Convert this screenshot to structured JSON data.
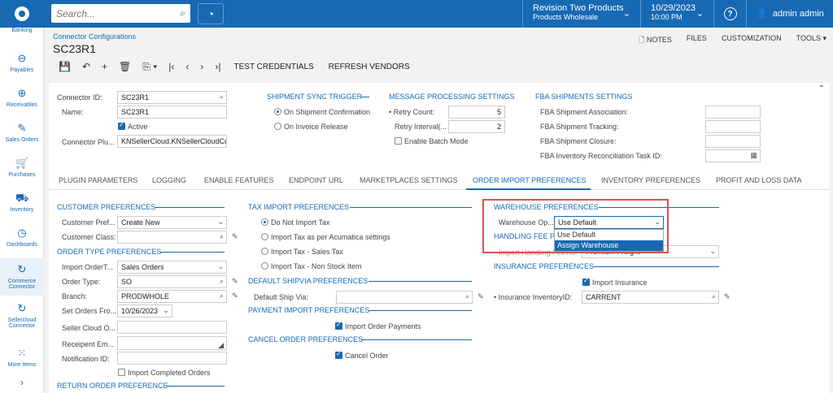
{
  "topbar": {
    "search_placeholder": "Search...",
    "company_name": "Revision Two Products",
    "company_sub": "Products Wholesale",
    "date": "10/29/2023",
    "time": "10:00 PM",
    "user": "admin admin"
  },
  "sidebar": {
    "items": [
      {
        "label": "Banking"
      },
      {
        "label": "Payables"
      },
      {
        "label": "Receivables"
      },
      {
        "label": "Sales Orders"
      },
      {
        "label": "Purchases"
      },
      {
        "label": "Inventory"
      },
      {
        "label": "Dashboards"
      },
      {
        "label": "Commerce Connector"
      },
      {
        "label": "Sellercloud Connector"
      },
      {
        "label": "More Items"
      }
    ]
  },
  "header": {
    "breadcrumb": "Connector Configurations",
    "title": "SC23R1",
    "notes": "NOTES",
    "files": "FILES",
    "customization": "CUSTOMIZATION",
    "tools": "TOOLS",
    "test_credentials": "TEST CREDENTIALS",
    "refresh_vendors": "REFRESH VENDORS"
  },
  "summary": {
    "connector_id_label": "Connector ID:",
    "connector_id": "SC23R1",
    "name_label": "Name:",
    "name": "SC23R1",
    "active_label": "Active",
    "plugin_label": "Connector Plu...",
    "plugin": "KNSellerCloud.KNSellerCloudCo",
    "shipment_sync_title": "SHIPMENT SYNC TRIGGER",
    "on_shipment": "On Shipment Confirmation",
    "on_invoice": "On Invoice Release",
    "msg_title": "MESSAGE PROCESSING SETTINGS",
    "retry_count_label": "Retry Count:",
    "retry_count": "5",
    "retry_interval_label": "Retry Interval(...",
    "retry_interval": "2",
    "batch_label": "Enable Batch Mode",
    "fba_title": "FBA SHIPMENTS SETTINGS",
    "fba_assoc": "FBA Shipment Association:",
    "fba_tracking": "FBA Shipment Tracking:",
    "fba_closure": "FBA Shipment Closure:",
    "fba_recon": "FBA Inventory Reconciliation Task ID:"
  },
  "tabs": [
    {
      "label": "PLUGIN PARAMETERS"
    },
    {
      "label": "LOGGING"
    },
    {
      "label": "ENABLE FEATURES"
    },
    {
      "label": "ENDPOINT URL"
    },
    {
      "label": "MARKETPLACES SETTINGS"
    },
    {
      "label": "ORDER IMPORT PREFERENCES"
    },
    {
      "label": "INVENTORY PREFERENCES"
    },
    {
      "label": "PROFIT AND LOSS DATA"
    }
  ],
  "customer": {
    "title": "CUSTOMER PREFERENCES",
    "pref_label": "Customer Pref...",
    "pref_value": "Create New",
    "class_label": "Customer Class:"
  },
  "order_type": {
    "title": "ORDER TYPE PREFERENCES",
    "import_label": "Import OrderT...",
    "import_value": "Sales Orders",
    "type_label": "Order Type:",
    "type_value": "SO",
    "branch_label": "Branch:",
    "branch_value": "PRODWHOLE",
    "set_orders_label": "Set Orders Fro...",
    "set_orders_value": "10/26/2023",
    "seller_label": "Seller Cloud O...",
    "recipient_label": "Receipent Em...",
    "notification_label": "Notification ID:",
    "import_completed": "Import Completed Orders"
  },
  "return_order": {
    "title": "RETURN ORDER PREFERENCE"
  },
  "tax": {
    "title": "TAX IMPORT PREFERENCES",
    "opt1": "Do Not Import Tax",
    "opt2": "Import Tax as per Acumatica settings",
    "opt3": "Import Tax - Sales Tax",
    "opt4": "Import Tax - Non Stock Item"
  },
  "shipvia": {
    "title": "DEFAULT SHIPVIA PREFERENCES",
    "label": "Default Ship Via:"
  },
  "payment": {
    "title": "PAYMENT IMPORT PREFERENCES",
    "label": "Import Order Payments"
  },
  "cancel": {
    "title": "CANCEL ORDER PREFERENCES",
    "label": "Cancel Order"
  },
  "warehouse": {
    "title": "WAREHOUSE PREFERENCES",
    "label": "Warehouse Op...",
    "value": "Use Default",
    "options": [
      "Use Default",
      "Assign Warehouse"
    ]
  },
  "handling": {
    "title": "HANDLING FEE P",
    "label": "Import Handling Fee As:",
    "value": "Premium Freight"
  },
  "insurance": {
    "title": "INSURANCE PREFERENCES",
    "import_label": "Import Insurance",
    "inv_label": "Insurance InventoryID:",
    "inv_value": "CARRENT"
  },
  "colors": {
    "accent": "#1769b4",
    "highlight": "#d9534f"
  }
}
